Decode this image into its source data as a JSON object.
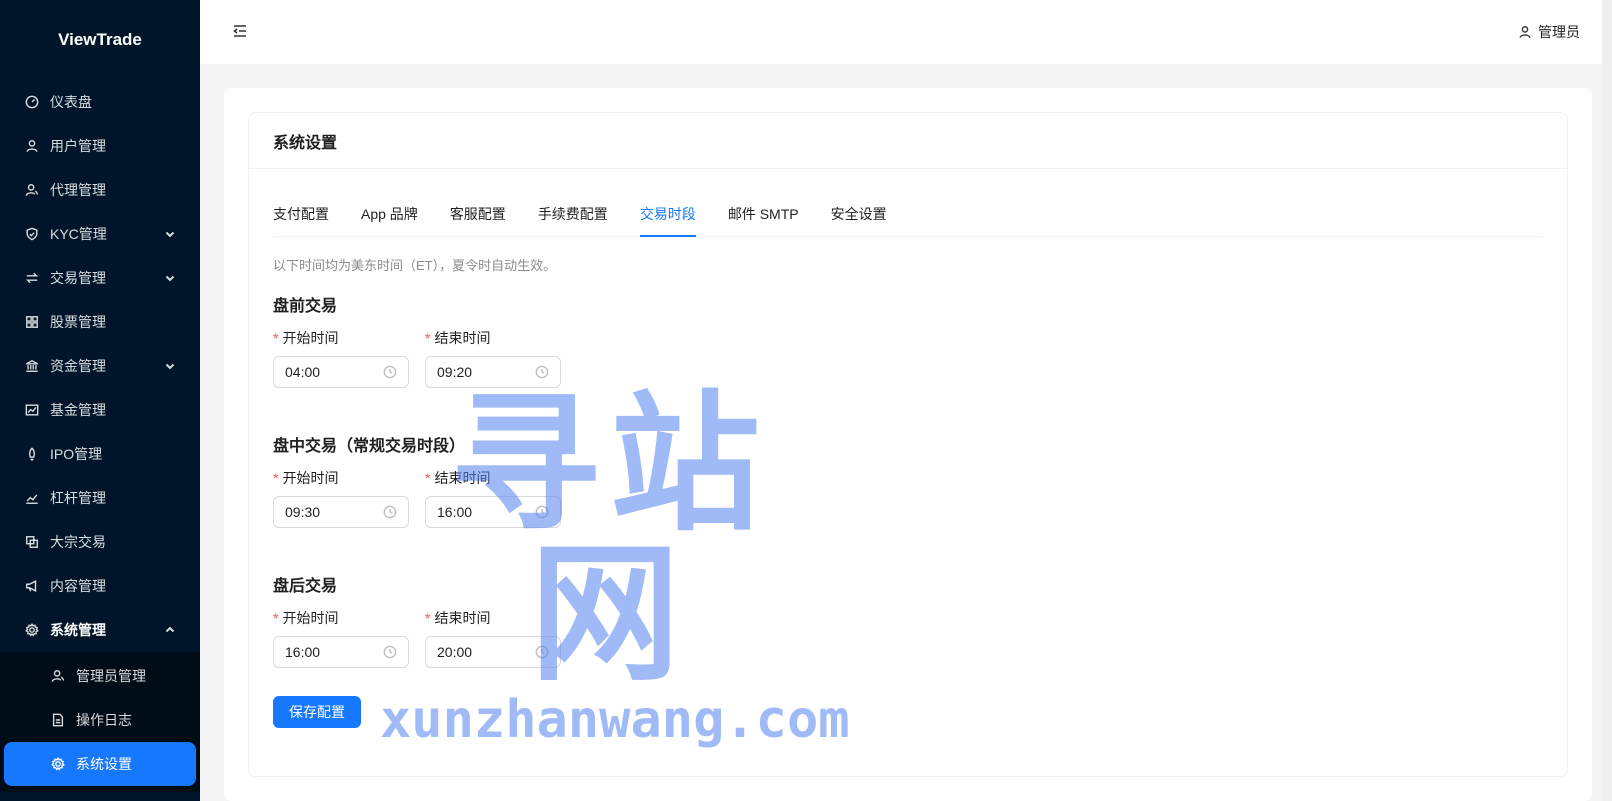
{
  "app": {
    "title": "ViewTrade"
  },
  "sidebar": {
    "items": [
      {
        "label": "仪表盘",
        "icon": "dashboard-icon"
      },
      {
        "label": "用户管理",
        "icon": "user-icon"
      },
      {
        "label": "代理管理",
        "icon": "agent-icon"
      },
      {
        "label": "KYC管理",
        "icon": "shield-icon",
        "expandable": true
      },
      {
        "label": "交易管理",
        "icon": "swap-icon",
        "expandable": true
      },
      {
        "label": "股票管理",
        "icon": "grid-icon"
      },
      {
        "label": "资金管理",
        "icon": "bank-icon",
        "expandable": true
      },
      {
        "label": "基金管理",
        "icon": "fund-chart-icon"
      },
      {
        "label": "IPO管理",
        "icon": "rocket-icon"
      },
      {
        "label": "杠杆管理",
        "icon": "line-chart-icon"
      },
      {
        "label": "大宗交易",
        "icon": "block-icon"
      },
      {
        "label": "内容管理",
        "icon": "megaphone-icon"
      },
      {
        "label": "系统管理",
        "icon": "gear-icon",
        "expanded": true
      }
    ],
    "sub_items": [
      {
        "label": "管理员管理",
        "icon": "admin-icon"
      },
      {
        "label": "操作日志",
        "icon": "file-icon"
      },
      {
        "label": "系统设置",
        "icon": "gear-icon",
        "active": true
      }
    ]
  },
  "header": {
    "user_label": "管理员"
  },
  "page": {
    "title": "系统设置",
    "tabs": [
      "支付配置",
      "App 品牌",
      "客服配置",
      "手续费配置",
      "交易时段",
      "邮件 SMTP",
      "安全设置"
    ],
    "active_tab": "交易时段",
    "hint": "以下时间均为美东时间（ET），夏令时自动生效。",
    "start_label": "开始时间",
    "end_label": "结束时间",
    "sections": [
      {
        "title": "盘前交易",
        "start": "04:00",
        "end": "09:20"
      },
      {
        "title": "盘中交易（常规交易时段）",
        "start": "09:30",
        "end": "16:00"
      },
      {
        "title": "盘后交易",
        "start": "16:00",
        "end": "20:00"
      }
    ],
    "save_label": "保存配置"
  },
  "watermark": {
    "cn": "寻站网",
    "en": "xunzhanwang.com"
  },
  "colors": {
    "sidebar_bg": "#001529",
    "primary": "#1677ff",
    "required": "#ff4d4f"
  }
}
